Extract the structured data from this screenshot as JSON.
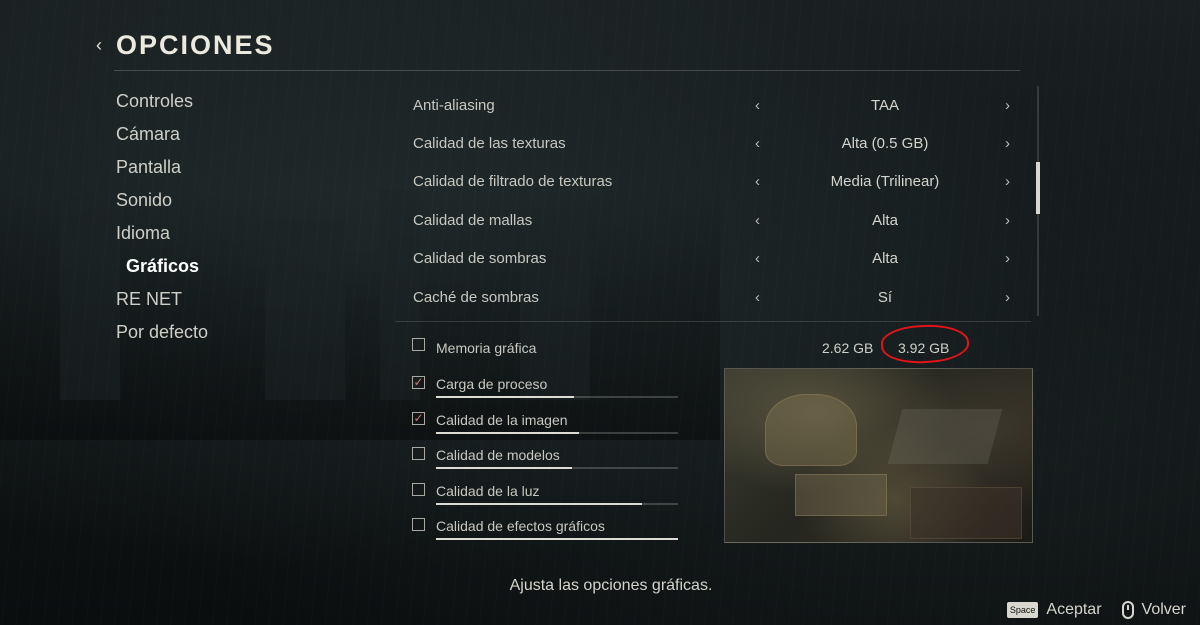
{
  "header": {
    "title": "OPCIONES",
    "back_icon": "chevron-left-icon"
  },
  "sidebar": {
    "items": [
      {
        "label": "Controles",
        "active": false
      },
      {
        "label": "Cámara",
        "active": false
      },
      {
        "label": "Pantalla",
        "active": false
      },
      {
        "label": "Sonido",
        "active": false
      },
      {
        "label": "Idioma",
        "active": false
      },
      {
        "label": "Gráficos",
        "active": true
      },
      {
        "label": "RE NET",
        "active": false
      },
      {
        "label": "Por defecto",
        "active": false
      }
    ]
  },
  "settings": [
    {
      "label": "Anti-aliasing",
      "value": "TAA"
    },
    {
      "label": "Calidad de las texturas",
      "value": "Alta (0.5 GB)"
    },
    {
      "label": "Calidad de filtrado de texturas",
      "value": "Media (Trilinear)"
    },
    {
      "label": "Calidad de mallas",
      "value": "Alta"
    },
    {
      "label": "Calidad de sombras",
      "value": "Alta"
    },
    {
      "label": "Caché de sombras",
      "value": "Sí"
    }
  ],
  "memory": {
    "label": "Memoria gráfica",
    "used": "2.62 GB",
    "total": "3.92 GB",
    "checked": false,
    "highlight_color": "#e2141a"
  },
  "load_items": [
    {
      "label": "Carga de proceso",
      "checked": true,
      "level": 0.57
    },
    {
      "label": "Calidad de la imagen",
      "checked": true,
      "level": 0.59
    },
    {
      "label": "Calidad de modelos",
      "checked": false,
      "level": 0.56
    },
    {
      "label": "Calidad de la luz",
      "checked": false,
      "level": 0.85
    },
    {
      "label": "Calidad de efectos gráficos",
      "checked": false,
      "level": 1.0
    }
  ],
  "description": "Ajusta las opciones gráficas.",
  "footer": {
    "accept_key": "Space",
    "accept_label": "Aceptar",
    "back_icon": "mouse-icon",
    "back_label": "Volver"
  },
  "colors": {
    "background": "#0e1213",
    "text": "#c9c9c3",
    "highlight": "#e2141a"
  }
}
